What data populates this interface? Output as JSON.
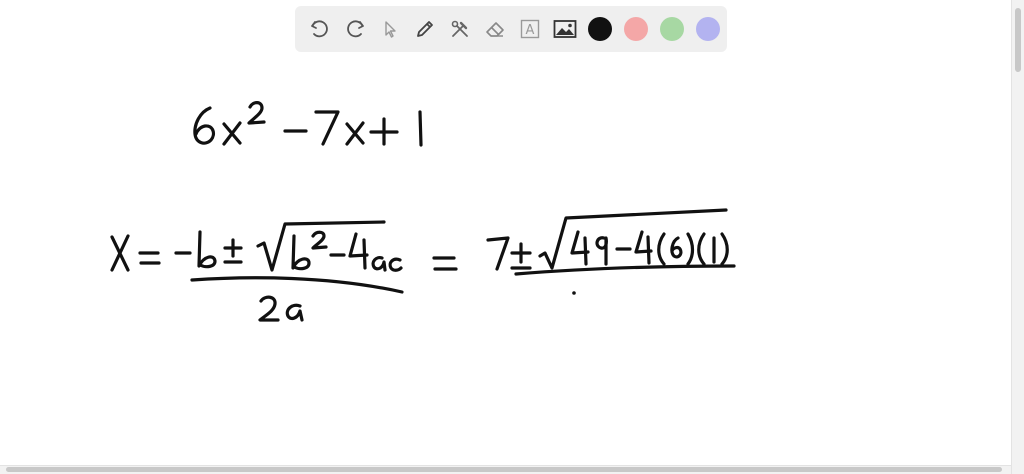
{
  "toolbar": {
    "tools": [
      {
        "name": "undo",
        "icon": "undo-icon"
      },
      {
        "name": "redo",
        "icon": "redo-icon"
      },
      {
        "name": "select",
        "icon": "pointer-icon"
      },
      {
        "name": "pen",
        "icon": "pencil-icon"
      },
      {
        "name": "tools",
        "icon": "tools-icon"
      },
      {
        "name": "eraser",
        "icon": "eraser-icon"
      },
      {
        "name": "text",
        "icon": "text-box-icon",
        "label": "A"
      },
      {
        "name": "image",
        "icon": "image-icon"
      }
    ],
    "colors": [
      "#111111",
      "#f4a7a7",
      "#a7d8a3",
      "#b3b3f0"
    ],
    "selected_color": "#111111"
  },
  "handwriting": {
    "expression": "6x² − 7x + 1",
    "quadratic_formula": "x = (−b ± √(b² − 4ac)) / 2a",
    "substitution": "= 7 ± √(49 − 4(6)(1))"
  }
}
